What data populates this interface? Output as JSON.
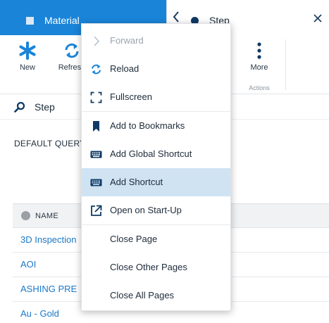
{
  "tabs": {
    "material": {
      "label": "Material"
    },
    "step": {
      "label": "Step"
    }
  },
  "ribbon": {
    "new_label": "New",
    "refresh_label": "Refresh",
    "more_label": "More",
    "group_label": "Actions"
  },
  "search": {
    "value": "Step"
  },
  "section_label": "DEFAULT QUERY",
  "grid": {
    "header": "NAME",
    "rows": [
      {
        "name": "3D Inspection"
      },
      {
        "name": "AOI"
      },
      {
        "name": "ASHING PRE"
      },
      {
        "name": "Au - Gold"
      }
    ]
  },
  "context_menu": {
    "items": [
      {
        "label": "Forward",
        "icon": "chevron-right-icon",
        "disabled": true
      },
      {
        "label": "Reload",
        "icon": "reload-icon"
      },
      {
        "label": "Fullscreen",
        "icon": "fullscreen-icon"
      },
      {
        "label": "Add to Bookmarks",
        "icon": "bookmark-icon"
      },
      {
        "label": "Add Global Shortcut",
        "icon": "keyboard-icon"
      },
      {
        "label": "Add Shortcut",
        "icon": "keyboard-icon",
        "highlighted": true
      },
      {
        "label": "Open on Start-Up",
        "icon": "open-external-icon"
      },
      {
        "label": "Close Page"
      },
      {
        "label": "Close Other Pages"
      },
      {
        "label": "Close All Pages"
      }
    ]
  },
  "colors": {
    "accent": "#1a84d8",
    "link": "#1a78c8",
    "highlight": "#cfe3f3",
    "dark_icon": "#0f3a64"
  }
}
